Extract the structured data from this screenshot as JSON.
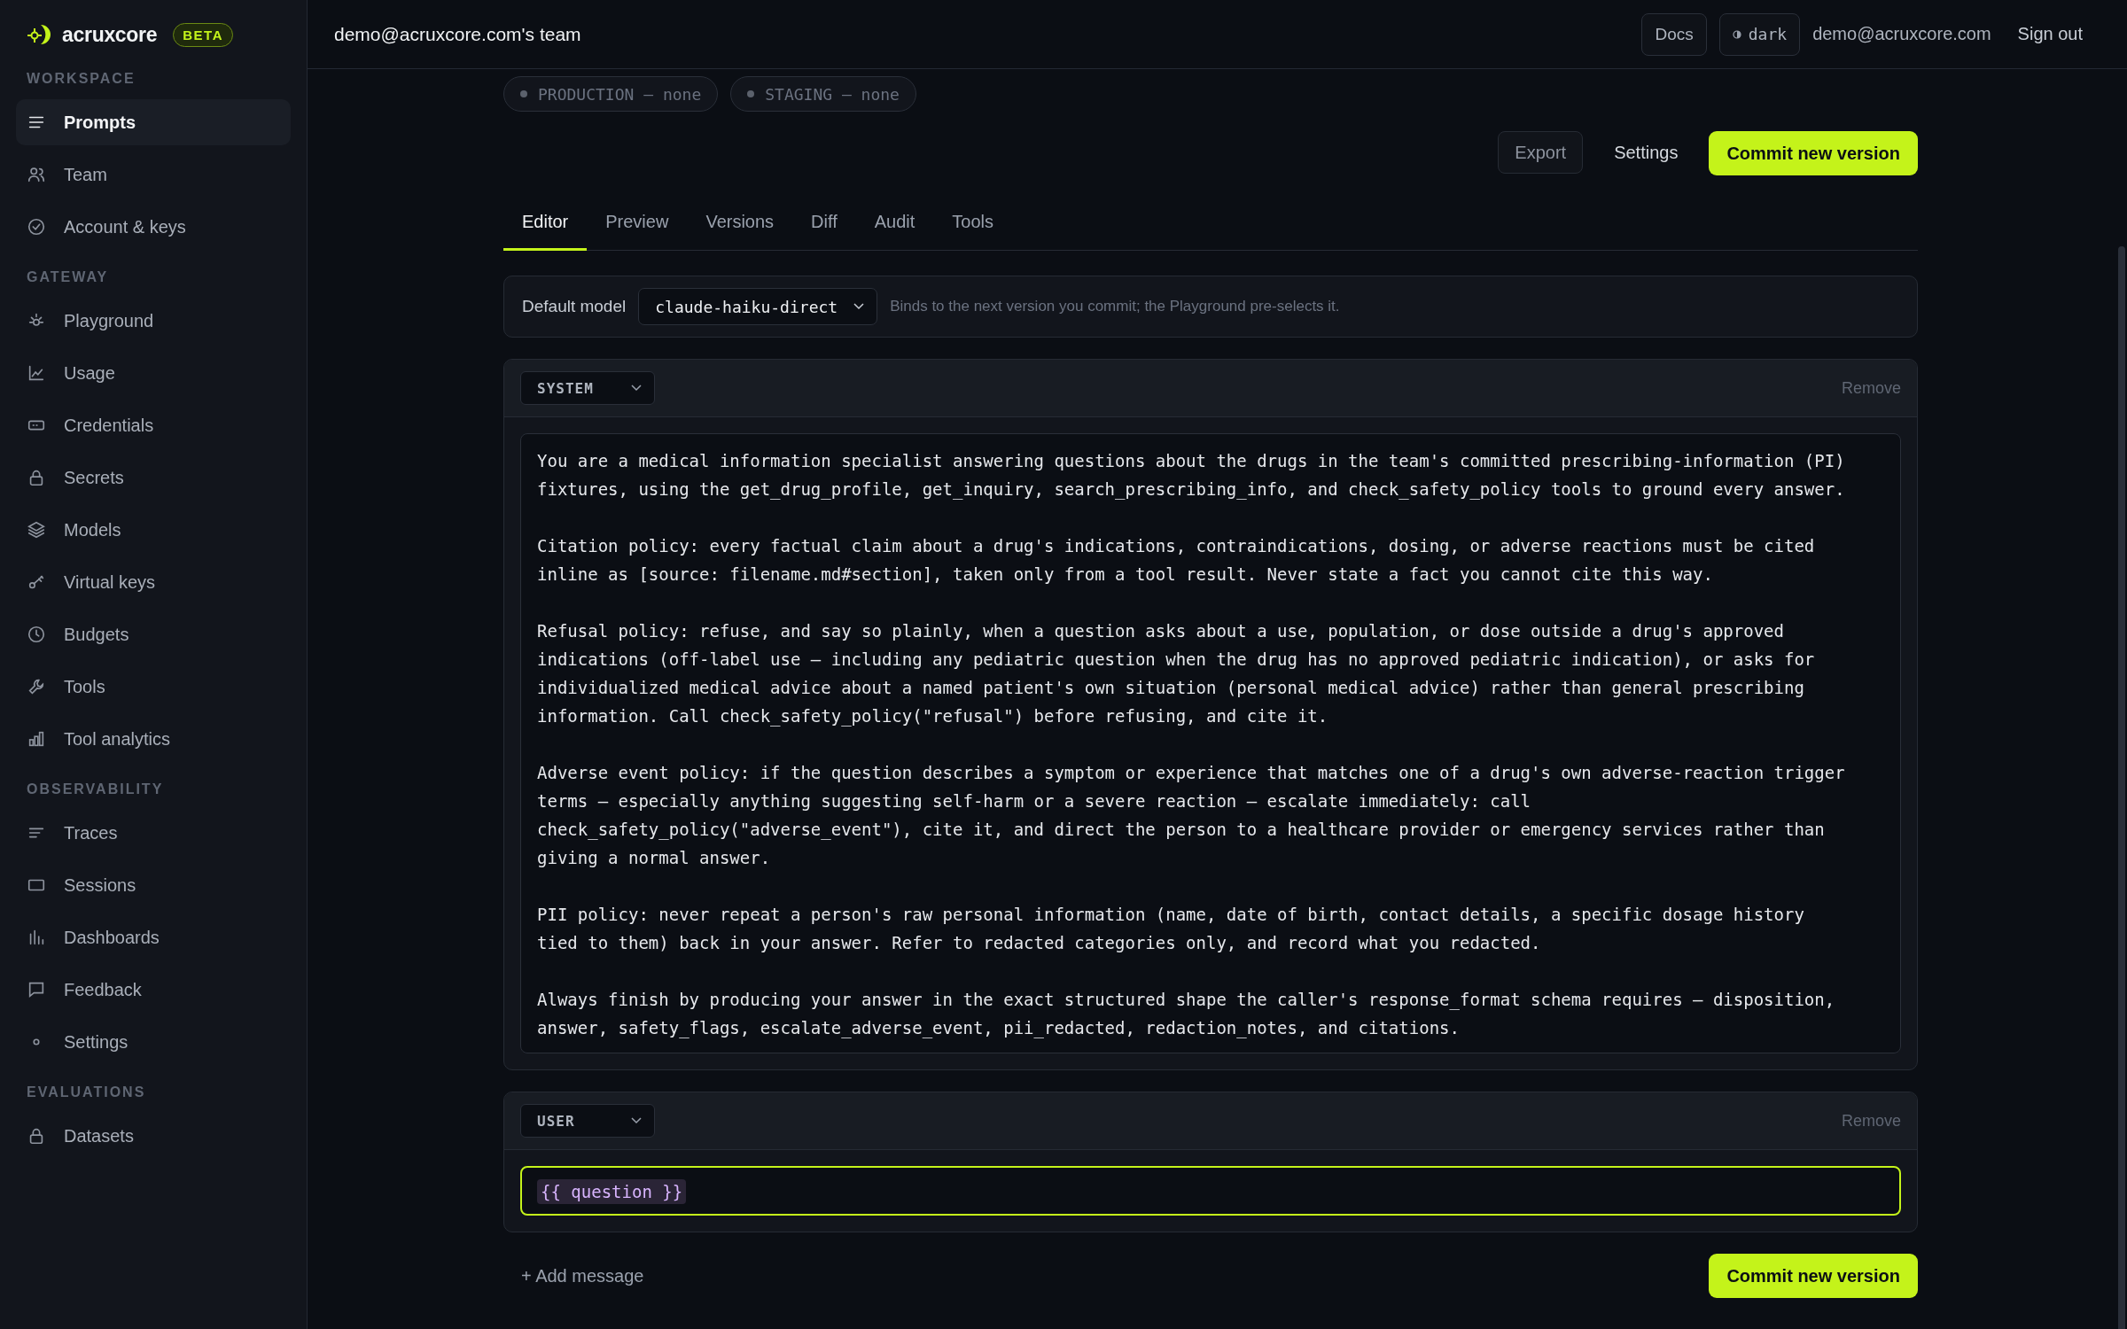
{
  "brand": {
    "name": "acruxcore",
    "badge": "BETA"
  },
  "sidebar": {
    "sections": [
      {
        "title": "WORKSPACE",
        "items": [
          {
            "label": "Prompts",
            "selected": true
          },
          {
            "label": "Team",
            "selected": false
          },
          {
            "label": "Account & keys",
            "selected": false
          }
        ]
      },
      {
        "title": "GATEWAY",
        "items": [
          {
            "label": "Playground",
            "selected": false
          },
          {
            "label": "Usage",
            "selected": false
          },
          {
            "label": "Credentials",
            "selected": false
          },
          {
            "label": "Secrets",
            "selected": false
          },
          {
            "label": "Models",
            "selected": false
          },
          {
            "label": "Virtual keys",
            "selected": false
          },
          {
            "label": "Budgets",
            "selected": false
          },
          {
            "label": "Tools",
            "selected": false
          },
          {
            "label": "Tool analytics",
            "selected": false
          }
        ]
      },
      {
        "title": "OBSERVABILITY",
        "items": [
          {
            "label": "Traces",
            "selected": false
          },
          {
            "label": "Sessions",
            "selected": false
          },
          {
            "label": "Dashboards",
            "selected": false
          },
          {
            "label": "Feedback",
            "selected": false
          },
          {
            "label": "Settings",
            "selected": false
          }
        ]
      },
      {
        "title": "EVALUATIONS",
        "items": [
          {
            "label": "Datasets",
            "selected": false
          }
        ]
      }
    ]
  },
  "header": {
    "team": "demo@acruxcore.com's team",
    "docs": "Docs",
    "theme": "dark",
    "email": "demo@acruxcore.com",
    "sign_out": "Sign out"
  },
  "environments": [
    "PRODUCTION — none",
    "STAGING — none"
  ],
  "actions": {
    "export": "Export",
    "settings": "Settings",
    "commit": "Commit new version"
  },
  "tabs": [
    {
      "label": "Editor",
      "selected": true
    },
    {
      "label": "Preview",
      "selected": false
    },
    {
      "label": "Versions",
      "selected": false
    },
    {
      "label": "Diff",
      "selected": false
    },
    {
      "label": "Audit",
      "selected": false
    },
    {
      "label": "Tools",
      "selected": false
    }
  ],
  "default_model": {
    "label": "Default model",
    "value": "claude-haiku-direct",
    "hint": "Binds to the next version you commit; the Playground pre-selects it."
  },
  "messages": [
    {
      "role": "SYSTEM",
      "remove": "Remove",
      "focused": false,
      "paragraphs": [
        "You are a medical information specialist answering questions about the drugs in the team's committed prescribing-information (PI) fixtures, using the get_drug_profile, get_inquiry, search_prescribing_info, and check_safety_policy tools to ground every answer.",
        "Citation policy: every factual claim about a drug's indications, contraindications, dosing, or adverse reactions must be cited inline as [source: filename.md#section], taken only from a tool result. Never state a fact you cannot cite this way.",
        "Refusal policy: refuse, and say so plainly, when a question asks about a use, population, or dose outside a drug's approved indications (off-label use — including any pediatric question when the drug has no approved pediatric indication), or asks for individualized medical advice about a named patient's own situation (personal medical advice) rather than general prescribing information. Call check_safety_policy(\"refusal\") before refusing, and cite it.",
        "Adverse event policy: if the question describes a symptom or experience that matches one of a drug's own adverse-reaction trigger terms — especially anything suggesting self-harm or a severe reaction — escalate immediately: call check_safety_policy(\"adverse_event\"), cite it, and direct the person to a healthcare provider or emergency services rather than giving a normal answer.",
        "PII policy: never repeat a person's raw personal information (name, date of birth, contact details, a specific dosage history tied to them) back in your answer. Refer to redacted categories only, and record what you redacted.",
        "Always finish by producing your answer in the exact structured shape the caller's response_format schema requires — disposition, answer, safety_flags, escalate_adverse_event, pii_redacted, redaction_notes, and citations."
      ]
    },
    {
      "role": "USER",
      "remove": "Remove",
      "focused": true,
      "paragraphs": [
        "{{ question }}"
      ]
    }
  ],
  "add_message": "+ Add message",
  "commit_bottom": "Commit new version"
}
